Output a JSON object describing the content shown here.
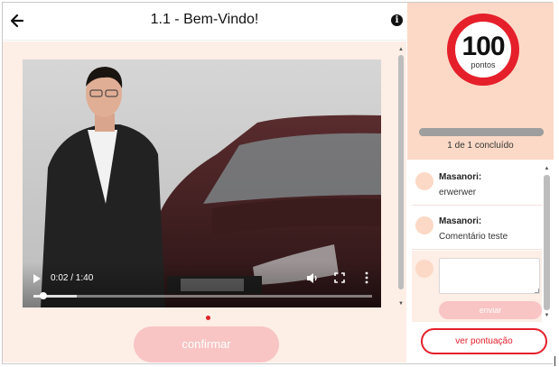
{
  "header": {
    "title": "1.1 - Bem-Vindo!",
    "back_icon": "arrow-left-icon",
    "info_icon": "info-icon",
    "info_glyph": "i"
  },
  "video": {
    "current_time": "0:02",
    "duration": "1:40",
    "time_label": "0:02 / 1:40",
    "progress_fraction": 0.02,
    "icons": [
      "play-icon",
      "volume-icon",
      "fullscreen-icon",
      "more-vertical-icon"
    ]
  },
  "lesson": {
    "confirm_label": "confirmar"
  },
  "score": {
    "value": "100",
    "unit": "pontos",
    "progress_text": "1 de 1 concluído",
    "progress_fraction": 1.0
  },
  "comments": [
    {
      "author": "Masanori:",
      "text": "erwerwer"
    },
    {
      "author": "Masanori:",
      "text": "Comentário teste"
    }
  ],
  "composer": {
    "value": "",
    "send_label": "enviar"
  },
  "footer": {
    "view_score_label": "ver pontuação"
  },
  "colors": {
    "accent": "#e5202b",
    "peach": "#fbd9c6",
    "light_peach": "#fdeee6",
    "button_disabled": "#f8c4c4"
  }
}
